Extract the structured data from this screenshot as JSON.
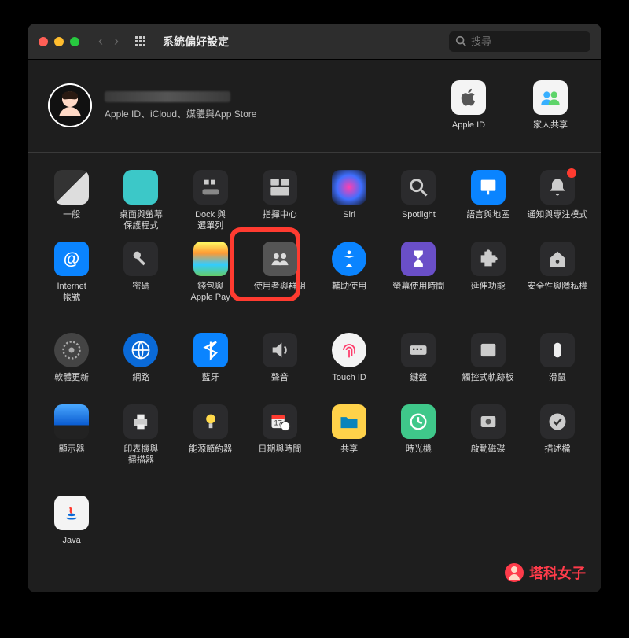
{
  "window": {
    "title": "系統偏好設定",
    "search_placeholder": "搜尋"
  },
  "profile": {
    "subtitle": "Apple ID、iCloud、媒體與App Store",
    "apple_id_label": "Apple ID",
    "family_label": "家人共享"
  },
  "section1": [
    {
      "label": "一般"
    },
    {
      "label": "桌面與螢幕\n保護程式"
    },
    {
      "label": "Dock 與\n選單列"
    },
    {
      "label": "指揮中心"
    },
    {
      "label": "Siri"
    },
    {
      "label": "Spotlight"
    },
    {
      "label": "語言與地區"
    },
    {
      "label": "通知與專注模式"
    },
    {
      "label": "Internet\n帳號"
    },
    {
      "label": "密碼"
    },
    {
      "label": "錢包與\nApple Pay"
    },
    {
      "label": "使用者與群組"
    },
    {
      "label": "輔助使用"
    },
    {
      "label": "螢幕使用時間"
    },
    {
      "label": "延伸功能"
    },
    {
      "label": "安全性與隱私權"
    }
  ],
  "section2": [
    {
      "label": "軟體更新"
    },
    {
      "label": "網路"
    },
    {
      "label": "藍牙"
    },
    {
      "label": "聲音"
    },
    {
      "label": "Touch ID"
    },
    {
      "label": "鍵盤"
    },
    {
      "label": "觸控式軌跡板"
    },
    {
      "label": "滑鼠"
    },
    {
      "label": "顯示器"
    },
    {
      "label": "印表機與\n掃描器"
    },
    {
      "label": "能源節約器"
    },
    {
      "label": "日期與時間"
    },
    {
      "label": "共享"
    },
    {
      "label": "時光機"
    },
    {
      "label": "啟動磁碟"
    },
    {
      "label": "描述檔"
    }
  ],
  "section3": [
    {
      "label": "Java"
    }
  ],
  "watermark": "塔科女子",
  "highlighted_item": "使用者與群組"
}
